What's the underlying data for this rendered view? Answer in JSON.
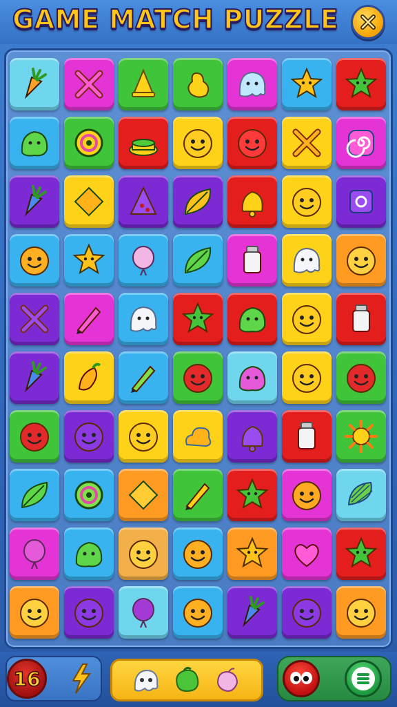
{
  "header": {
    "title": "GAME MATCH PUZZLE",
    "close_icon": "close-x-icon"
  },
  "colors": {
    "red": "#e41d1d",
    "green": "#3fc43a",
    "purple": "#7b2ad4",
    "magenta": "#e534d6",
    "yellow": "#ffd21a",
    "cyan": "#38b3ef",
    "orange": "#ff9a22",
    "lightcyan": "#6fd6ee",
    "peach": "#f3b04a"
  },
  "board": {
    "rows": [
      [
        {
          "bg": "lightcyan",
          "icon": "carrot"
        },
        {
          "bg": "magenta",
          "icon": "cross-sticks"
        },
        {
          "bg": "green",
          "icon": "cone"
        },
        {
          "bg": "green",
          "icon": "pear"
        },
        {
          "bg": "magenta",
          "icon": "ghost"
        },
        {
          "bg": "cyan",
          "icon": "star"
        },
        {
          "bg": "red",
          "icon": "star"
        }
      ],
      [
        {
          "bg": "cyan",
          "icon": "blob"
        },
        {
          "bg": "green",
          "icon": "swirl-ring"
        },
        {
          "bg": "red",
          "icon": "pot"
        },
        {
          "bg": "yellow",
          "icon": "face"
        },
        {
          "bg": "red",
          "icon": "face"
        },
        {
          "bg": "yellow",
          "icon": "cross-sticks"
        },
        {
          "bg": "magenta",
          "icon": "swirl"
        }
      ],
      [
        {
          "bg": "purple",
          "icon": "carrot"
        },
        {
          "bg": "yellow",
          "icon": "diamond"
        },
        {
          "bg": "purple",
          "icon": "pizza"
        },
        {
          "bg": "purple",
          "icon": "leaf"
        },
        {
          "bg": "red",
          "icon": "bell"
        },
        {
          "bg": "yellow",
          "icon": "face"
        },
        {
          "bg": "purple",
          "icon": "square-swirl"
        }
      ],
      [
        {
          "bg": "cyan",
          "icon": "face"
        },
        {
          "bg": "cyan",
          "icon": "star"
        },
        {
          "bg": "cyan",
          "icon": "balloon"
        },
        {
          "bg": "cyan",
          "icon": "leaf"
        },
        {
          "bg": "magenta",
          "icon": "jar"
        },
        {
          "bg": "yellow",
          "icon": "ghost"
        },
        {
          "bg": "orange",
          "icon": "face"
        }
      ],
      [
        {
          "bg": "purple",
          "icon": "cross-sticks"
        },
        {
          "bg": "magenta",
          "icon": "pencil"
        },
        {
          "bg": "cyan",
          "icon": "ghost"
        },
        {
          "bg": "red",
          "icon": "star"
        },
        {
          "bg": "red",
          "icon": "blob"
        },
        {
          "bg": "yellow",
          "icon": "face"
        },
        {
          "bg": "red",
          "icon": "jar"
        }
      ],
      [
        {
          "bg": "purple",
          "icon": "carrot"
        },
        {
          "bg": "yellow",
          "icon": "pepper"
        },
        {
          "bg": "cyan",
          "icon": "pencil"
        },
        {
          "bg": "green",
          "icon": "face"
        },
        {
          "bg": "lightcyan",
          "icon": "blob"
        },
        {
          "bg": "yellow",
          "icon": "face"
        },
        {
          "bg": "green",
          "icon": "face"
        }
      ],
      [
        {
          "bg": "green",
          "icon": "face"
        },
        {
          "bg": "purple",
          "icon": "face"
        },
        {
          "bg": "yellow",
          "icon": "face"
        },
        {
          "bg": "yellow",
          "icon": "cloud"
        },
        {
          "bg": "purple",
          "icon": "bell"
        },
        {
          "bg": "red",
          "icon": "jar"
        },
        {
          "bg": "green",
          "icon": "sun"
        }
      ],
      [
        {
          "bg": "cyan",
          "icon": "leaf"
        },
        {
          "bg": "cyan",
          "icon": "swirl-ring"
        },
        {
          "bg": "orange",
          "icon": "diamond"
        },
        {
          "bg": "green",
          "icon": "pencil"
        },
        {
          "bg": "red",
          "icon": "star"
        },
        {
          "bg": "magenta",
          "icon": "face"
        },
        {
          "bg": "lightcyan",
          "icon": "shell"
        }
      ],
      [
        {
          "bg": "magenta",
          "icon": "balloon"
        },
        {
          "bg": "cyan",
          "icon": "blob"
        },
        {
          "bg": "peach",
          "icon": "face"
        },
        {
          "bg": "cyan",
          "icon": "face"
        },
        {
          "bg": "orange",
          "icon": "star"
        },
        {
          "bg": "magenta",
          "icon": "heart"
        },
        {
          "bg": "red",
          "icon": "star"
        }
      ],
      [
        {
          "bg": "orange",
          "icon": "face"
        },
        {
          "bg": "purple",
          "icon": "face"
        },
        {
          "bg": "lightcyan",
          "icon": "balloon"
        },
        {
          "bg": "cyan",
          "icon": "face"
        },
        {
          "bg": "purple",
          "icon": "carrot"
        },
        {
          "bg": "purple",
          "icon": "face"
        },
        {
          "bg": "orange",
          "icon": "face"
        }
      ]
    ]
  },
  "bottom": {
    "score": "16",
    "hint_icon": "lightning-icon",
    "boosters": [
      "ghost-booster",
      "blob-booster",
      "balloon-booster"
    ],
    "buttons": [
      "red-face-button",
      "menu-button"
    ]
  }
}
